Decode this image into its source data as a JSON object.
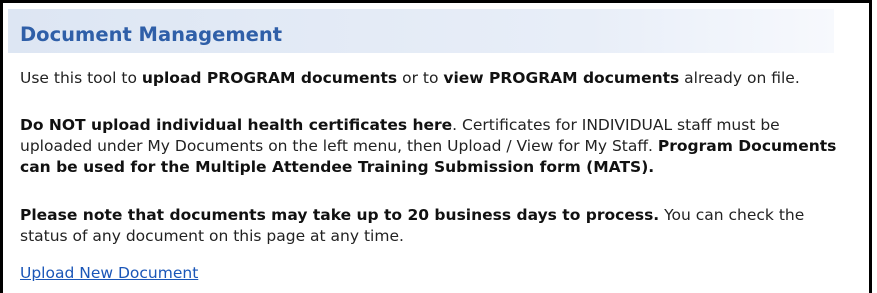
{
  "header": {
    "title": "Document Management"
  },
  "intro": {
    "t1": "Use this tool to ",
    "b1": "upload PROGRAM documents",
    "t2": " or to ",
    "b2": "view PROGRAM documents",
    "t3": " already on file."
  },
  "warning": {
    "bold_lead": "Do NOT upload individual health certificates here",
    "line1_rest": ". Certificates for INDIVIDUAL staff must be",
    "line2_text": "uploaded under My Documents on the left menu, then Upload / View for My Staff.  ",
    "line2_bold": "Program Documents",
    "line3_bold": "can be used for the Multiple Attendee Training Submission form (MATS)."
  },
  "note": {
    "bold": "Please note that documents may take up to 20 business days to process.",
    "line1_rest": " You can check the",
    "line2": "status of any document on this page at any time."
  },
  "actions": {
    "upload_link": "Upload New Document"
  },
  "colors": {
    "title": "#2f5fa8",
    "link": "#1a56b8",
    "header_bg": "#dde6f3",
    "border": "#000000"
  }
}
